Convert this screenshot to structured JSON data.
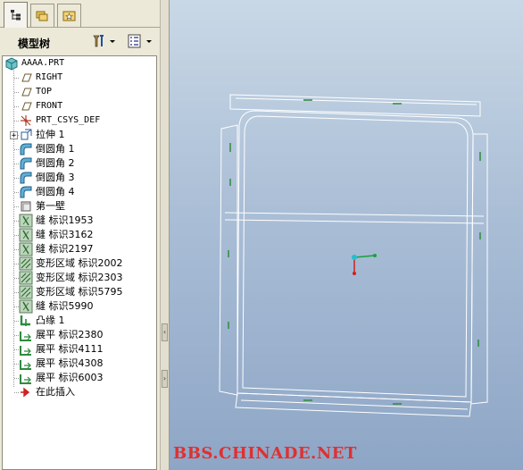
{
  "tabs": [
    {
      "name": "model-tree-tab",
      "icon": "tree-icon"
    },
    {
      "name": "folder-browser-tab",
      "icon": "folders-icon"
    },
    {
      "name": "favorites-tab",
      "icon": "star-icon"
    }
  ],
  "tree_header": {
    "title": "模型树",
    "settings_icon": "settings-icon",
    "show_icon": "show-icon"
  },
  "tree": {
    "root": "AAAA.PRT",
    "items": [
      {
        "label": "RIGHT",
        "icon": "datum-plane-icon"
      },
      {
        "label": "TOP",
        "icon": "datum-plane-icon"
      },
      {
        "label": "FRONT",
        "icon": "datum-plane-icon"
      },
      {
        "label": "PRT_CSYS_DEF",
        "icon": "csys-icon"
      },
      {
        "label": "拉伸 1",
        "icon": "extrude-icon"
      },
      {
        "label": "倒圆角 1",
        "icon": "round-icon"
      },
      {
        "label": "倒圆角 2",
        "icon": "round-icon"
      },
      {
        "label": "倒圆角 3",
        "icon": "round-icon"
      },
      {
        "label": "倒圆角 4",
        "icon": "round-icon"
      },
      {
        "label": "第一壁",
        "icon": "wall-icon"
      },
      {
        "label": "缝 标识1953",
        "icon": "rip-icon"
      },
      {
        "label": "缝 标识3162",
        "icon": "rip-icon"
      },
      {
        "label": "缝 标识2197",
        "icon": "rip-icon"
      },
      {
        "label": "变形区域 标识2002",
        "icon": "deform-area-icon"
      },
      {
        "label": "变形区域 标识2303",
        "icon": "deform-area-icon"
      },
      {
        "label": "变形区域 标识5795",
        "icon": "deform-area-icon"
      },
      {
        "label": "缝 标识5990",
        "icon": "rip-icon"
      },
      {
        "label": "凸缘 1",
        "icon": "flange-icon"
      },
      {
        "label": "展平 标识2380",
        "icon": "unbend-icon"
      },
      {
        "label": "展平 标识4111",
        "icon": "unbend-icon"
      },
      {
        "label": "展平 标识4308",
        "icon": "unbend-icon"
      },
      {
        "label": "展平 标识6003",
        "icon": "unbend-icon"
      },
      {
        "label": "在此插入",
        "icon": "insert-here-icon"
      }
    ]
  },
  "watermark": "BBS.CHINADE.NET",
  "colors": {
    "viewport_top": "#c9d8e6",
    "viewport_bottom": "#8ea6c6",
    "model_edge": "#ffffff",
    "model_highlight": "#2e8b3e",
    "watermark": "#e03030"
  }
}
